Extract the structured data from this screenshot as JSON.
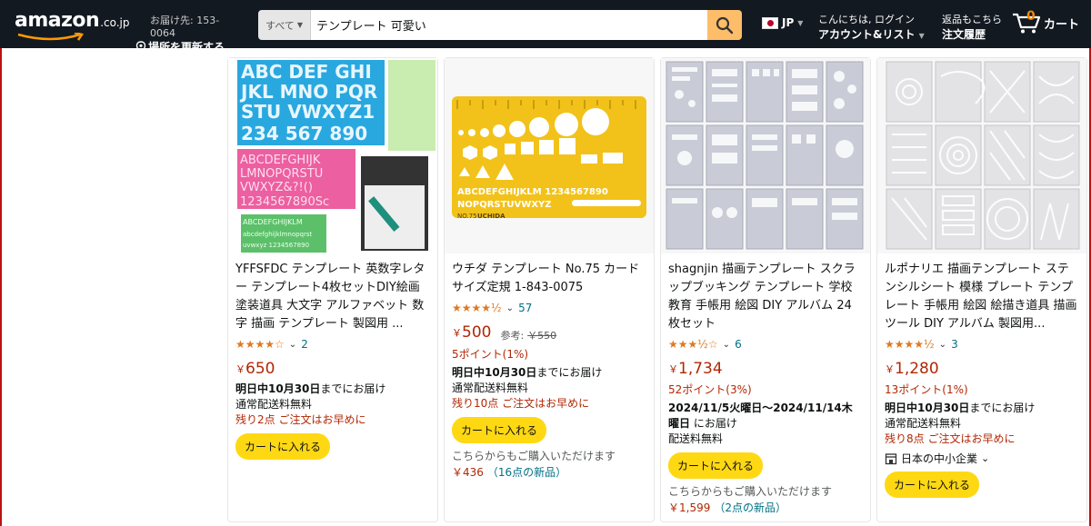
{
  "header": {
    "logo_text": "amazon",
    "logo_tld": ".co.jp",
    "deliver_line1": "お届け先: 153-0064",
    "deliver_line2": "場所を更新する",
    "search_category": "すべて",
    "search_value": "テンプレート 可愛い",
    "lang": "JP",
    "account_line1": "こんにちは, ログイン",
    "account_line2": "アカウント&リスト",
    "orders_line1": "返品もこちら",
    "orders_line2": "注文履歴",
    "cart_count": "0",
    "cart_label": "カート"
  },
  "products": [
    {
      "title": "YFFSFDC テンプレート 英数字レター テンプレート4枚セットDIY絵画塗装道具 大文字 アルファベット 数字 描画 テンプレート 製図用 ...",
      "stars": "★★★★☆",
      "rating_count": "2",
      "price_symbol": "￥",
      "price": "650",
      "delivery_bold": "明日中10月30日",
      "delivery_rest": "までにお届け",
      "shipping": "通常配送料無料",
      "stock": "残り2点 ご注文はお早めに",
      "cart_button": "カートに入れる"
    },
    {
      "title": "ウチダ テンプレート No.75 カードサイズ定規 1-843-0075",
      "stars": "★★★★½",
      "rating_count": "57",
      "price_symbol": "￥",
      "price": "500",
      "ref_label": "参考:",
      "ref_price": "￥550",
      "points": "5ポイント(1%)",
      "delivery_bold": "明日中10月30日",
      "delivery_rest": "までにお届け",
      "shipping": "通常配送料無料",
      "stock": "残り10点 ご注文はお早めに",
      "cart_button": "カートに入れる",
      "other_text": "こちらからもご購入いただけます",
      "other_price": "￥436",
      "other_link": "（16点の新品）"
    },
    {
      "title": "shagnjin 描画テンプレート スクラップブッキング テンプレート 学校 教育 手帳用 絵図 DIY アルバム 24枚セット",
      "stars": "★★★½☆",
      "rating_count": "6",
      "price_symbol": "￥",
      "price": "1,734",
      "points": "52ポイント(3%)",
      "delivery_bold": "2024/11/5火曜日～2024/11/14木曜日",
      "delivery_rest": "にお届け",
      "shipping": "配送料無料",
      "cart_button": "カートに入れる",
      "other_text": "こちらからもご購入いただけます",
      "other_price": "￥1,599",
      "other_link": "（2点の新品）"
    },
    {
      "title": "ルポナリエ 描画テンプレート ステンシルシート 模様 プレート テンプレート 手帳用 絵図 絵描き道具 描画ツール DIY アルバム 製図用...",
      "stars": "★★★★½",
      "rating_count": "3",
      "price_symbol": "￥",
      "price": "1,280",
      "points": "13ポイント(1%)",
      "delivery_bold": "明日中10月30日",
      "delivery_rest": "までにお届け",
      "shipping": "通常配送料無料",
      "stock": "残り8点 ご注文はお早めに",
      "small_business": "日本の中小企業",
      "cart_button": "カートに入れる"
    }
  ],
  "images": {
    "p1": {
      "row1": "ABC DEF GHI",
      "row2": "JKL MNO PQR",
      "row3": "STU VWXYZ1",
      "row4": "234 567 890",
      "pink1": "ABCDEFGHIJK",
      "pink2": "LMNOPQRSTU",
      "pink3": "VWXYZ&?!()",
      "pink4": "1234567890Sc",
      "green1": "ABCDEFGHIJKLM",
      "green2": "abcdefghijklmnopqrst",
      "green3": "uvwxyz 1234567890"
    },
    "p2": {
      "letters": "ABCDEFGHIJKLM 1234567890",
      "letters2": "NOPQRSTUVWXYZ",
      "model": "NO.75",
      "brand": "UCHIDA"
    }
  },
  "colors": {
    "header_bg": "#131921",
    "search_btn": "#febd69",
    "cart_btn": "#ffd814",
    "price": "#b12704",
    "link": "#007185",
    "star": "#de7921"
  }
}
